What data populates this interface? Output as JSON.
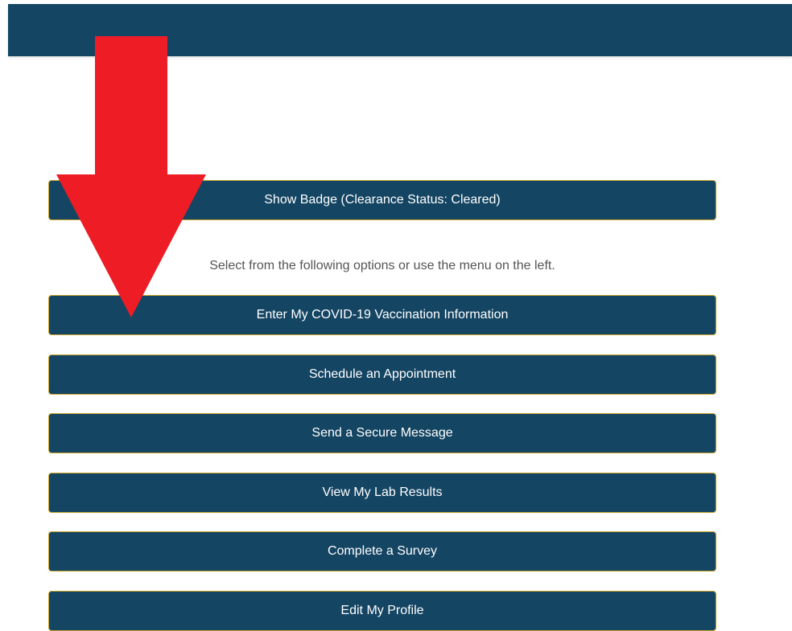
{
  "header": {
    "color": "#144563"
  },
  "badge_button": {
    "label": "Show Badge (Clearance Status: Cleared)"
  },
  "helper_text": "Select from the following options or use the menu on the left.",
  "actions": [
    {
      "label": "Enter My COVID-19 Vaccination Information"
    },
    {
      "label": "Schedule an Appointment"
    },
    {
      "label": "Send a Secure Message"
    },
    {
      "label": "View My Lab Results"
    },
    {
      "label": "Complete a Survey"
    },
    {
      "label": "Edit My Profile"
    }
  ],
  "annotation": {
    "icon": "down-arrow-icon",
    "color": "#ee1c25"
  },
  "colors": {
    "button_bg": "#144563",
    "button_border": "#c9a227",
    "button_text": "#ffffff"
  }
}
